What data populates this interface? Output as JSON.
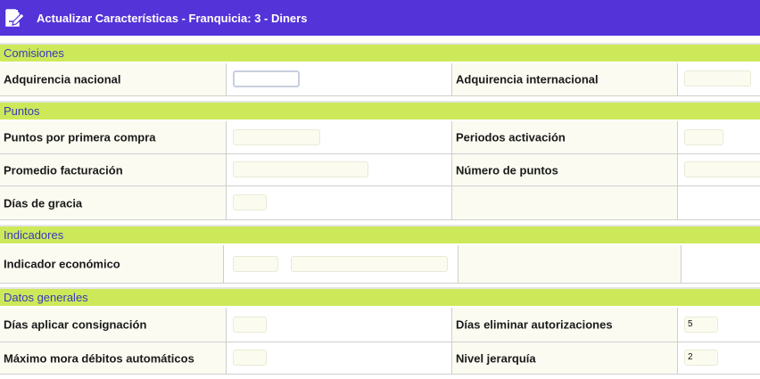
{
  "header": {
    "title": "Actualizar Características - Franquicia: 3 - Diners"
  },
  "sections": {
    "comisiones": "Comisiones",
    "puntos": "Puntos",
    "indicadores": "Indicadores",
    "datos_generales": "Datos generales"
  },
  "fields": {
    "adquirencia_nacional": {
      "label": "Adquirencia nacional",
      "value": ""
    },
    "adquirencia_internacional": {
      "label": "Adquirencia internacional",
      "value": ""
    },
    "puntos_primera_compra": {
      "label": "Puntos por primera compra",
      "value": ""
    },
    "periodos_activacion": {
      "label": "Periodos activación",
      "value": ""
    },
    "promedio_facturacion": {
      "label": "Promedio facturación",
      "value": ""
    },
    "numero_puntos": {
      "label": "Número de puntos",
      "value": ""
    },
    "dias_gracia": {
      "label": "Días de gracia",
      "value": ""
    },
    "indicador_economico": {
      "label": "Indicador económico",
      "code": "",
      "description": ""
    },
    "dias_aplicar_consignacion": {
      "label": "Días aplicar consignación",
      "value": ""
    },
    "dias_eliminar_autorizaciones": {
      "label": "Días eliminar autorizaciones",
      "value": "5"
    },
    "maximo_mora": {
      "label": "Máximo mora débitos automáticos",
      "value": ""
    },
    "nivel_jerarquia": {
      "label": "Nivel jerarquía",
      "value": "2"
    }
  },
  "icons": {
    "header_icon": "edit-document-icon"
  },
  "colors": {
    "header_bg": "#5433d8",
    "section_bg": "#cde95a",
    "section_text": "#3a3ab8"
  }
}
